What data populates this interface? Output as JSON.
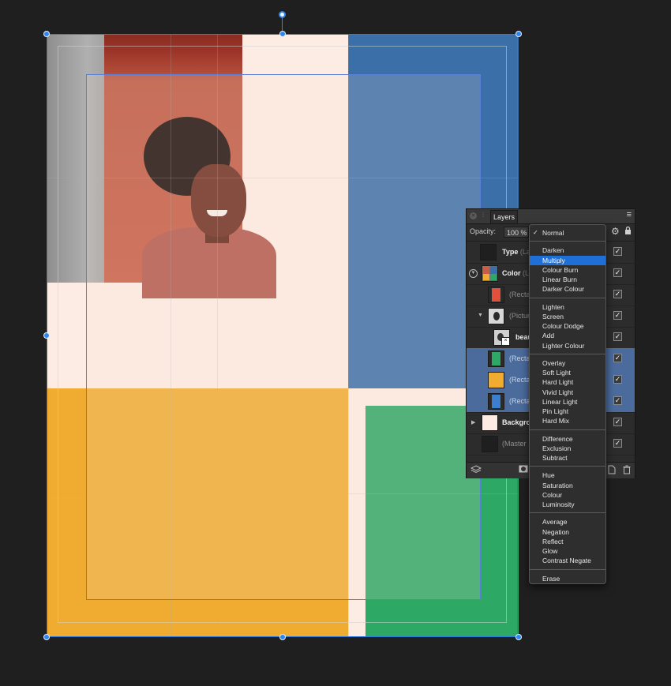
{
  "panel": {
    "tab_title": "Layers",
    "opacity_label": "Opacity:",
    "opacity_value": "100 %",
    "layers": [
      {
        "name": "Type",
        "suffix": " (La",
        "bold": true
      },
      {
        "name": "Color",
        "suffix": " (L",
        "bold": true
      },
      {
        "name": "(Recta",
        "suffix": "",
        "bold": false
      },
      {
        "name": "(Pictur",
        "suffix": "",
        "bold": false
      },
      {
        "name": "beau",
        "suffix": "",
        "bold": true
      },
      {
        "name": "(Recta",
        "suffix": "",
        "bold": false
      },
      {
        "name": "(Recta",
        "suffix": "",
        "bold": false
      },
      {
        "name": "(Recta",
        "suffix": "",
        "bold": false
      },
      {
        "name": "Backgro",
        "suffix": "",
        "bold": true
      },
      {
        "name": "(Master",
        "suffix": "",
        "bold": false
      }
    ],
    "check_glyph": "✓"
  },
  "blend_menu": {
    "selected": "Normal",
    "highlighted": "Multiply",
    "groups": [
      [
        "Normal"
      ],
      [
        "Darken",
        "Multiply",
        "Colour Burn",
        "Linear Burn",
        "Darker Colour"
      ],
      [
        "Lighten",
        "Screen",
        "Colour Dodge",
        "Add",
        "Lighter Colour"
      ],
      [
        "Overlay",
        "Soft Light",
        "Hard Light",
        "Vivid Light",
        "Linear Light",
        "Pin Light",
        "Hard Mix"
      ],
      [
        "Difference",
        "Exclusion",
        "Subtract"
      ],
      [
        "Hue",
        "Saturation",
        "Colour",
        "Luminosity"
      ],
      [
        "Average",
        "Negation",
        "Reflect",
        "Glow",
        "Contrast Negate"
      ],
      [
        "Erase"
      ]
    ]
  },
  "colors": {
    "background": "#1f1f1f",
    "page": "#fdece3",
    "red": "#c75d45",
    "blue": "#3b6fa8",
    "yellow": "#f0ab31",
    "green": "#2ea865",
    "selection": "#2f86f0",
    "menu_highlight": "#1f6fd6"
  },
  "icons": {
    "panel_close": "close-icon",
    "panel_menu": "hamburger-menu-icon",
    "settings": "gear-icon",
    "lock": "lock-icon",
    "footer": [
      "layers-stack-icon",
      "mask-icon",
      "add-layer-icon",
      "trash-icon"
    ]
  }
}
